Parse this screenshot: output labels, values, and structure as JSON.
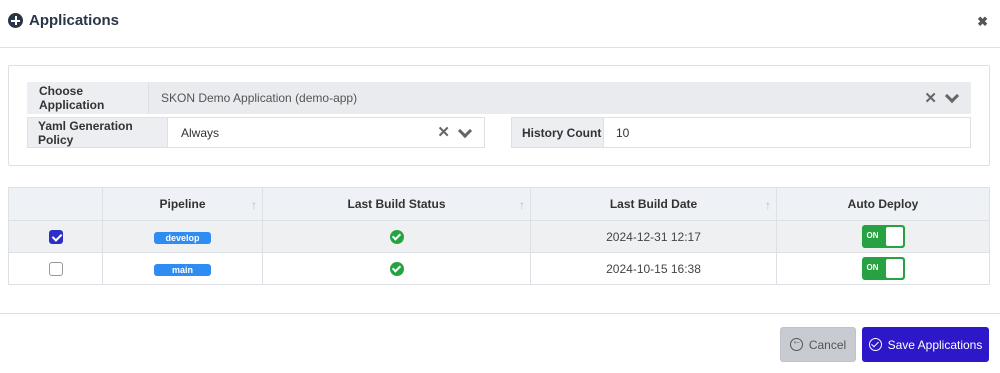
{
  "header": {
    "title": "Applications",
    "icon": "plus-circle-icon",
    "close_icon": "close-icon"
  },
  "form": {
    "choose_application": {
      "label": "Choose Application",
      "value": "SKON Demo Application (demo-app)"
    },
    "yaml_policy": {
      "label": "Yaml Generation Policy",
      "value": "Always"
    },
    "history_count": {
      "label": "History Count",
      "value": "10"
    }
  },
  "table": {
    "columns": [
      "Pipeline",
      "Last Build Status",
      "Last Build Date",
      "Auto Deploy"
    ],
    "rows": [
      {
        "selected": true,
        "pipeline": "develop",
        "status": "success",
        "date": "2024-12-31 12:17",
        "auto_deploy": "ON"
      },
      {
        "selected": false,
        "pipeline": "main",
        "status": "success",
        "date": "2024-10-15 16:38",
        "auto_deploy": "ON"
      }
    ]
  },
  "footer": {
    "cancel_label": "Cancel",
    "save_label": "Save Applications"
  },
  "colors": {
    "primary": "#2c18c8",
    "success": "#27a243",
    "badge": "#2f8cf3"
  }
}
